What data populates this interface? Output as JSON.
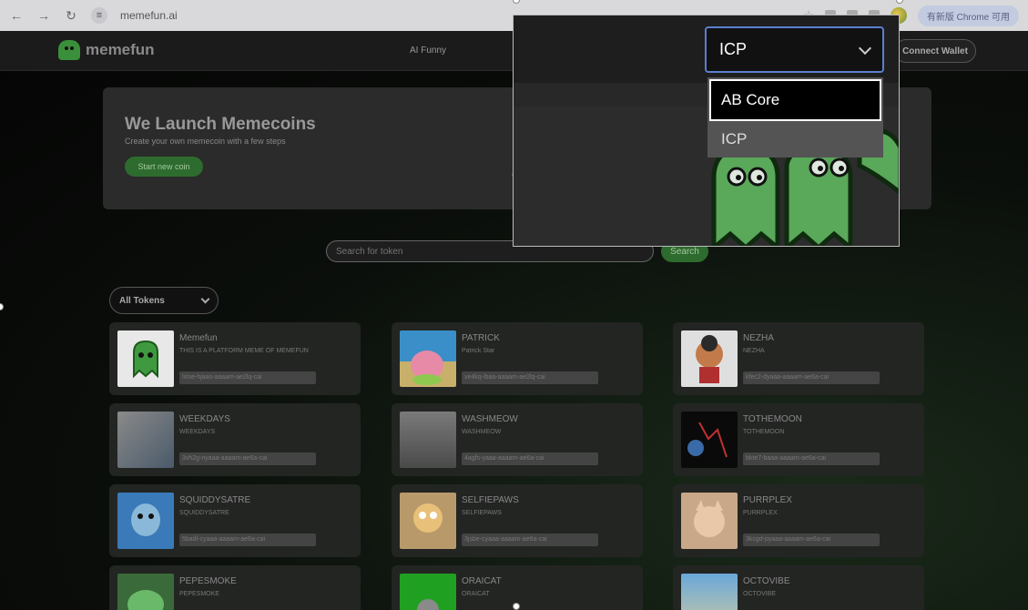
{
  "browser": {
    "url": "memefun.ai",
    "update_label": "有新版 Chrome 可用"
  },
  "header": {
    "logo_text": "memefun",
    "nav_link": "AI Funny",
    "connect_label": "Connect Wallet"
  },
  "hero": {
    "title": "We Launch Memecoins",
    "subtitle": "Create your own memecoin with a few steps",
    "cta": "Start new coin"
  },
  "search": {
    "placeholder": "Search for token",
    "button": "Search"
  },
  "filter": {
    "selected": "All Tokens"
  },
  "tokens": [
    {
      "name": "Memefun",
      "desc": "THIS IS A PLATFORM MEME OF MEMEFUN",
      "addr": "lxlse-hjaas-aaaam-ae2lq-cai"
    },
    {
      "name": "PATRICK",
      "desc": "Patrick Star",
      "addr": "xe4kq-lbaa-aaaam-ae2lq-cai"
    },
    {
      "name": "NEZHA",
      "desc": "NEZHA",
      "addr": "kfec2-dyaaa-aaaam-ae6a-cai"
    },
    {
      "name": "WEEKDAYS",
      "desc": "WEEKDAYS",
      "addr": "3vh2g-nyaaa-aaaam-ae6a-cai"
    },
    {
      "name": "WASHMEOW",
      "desc": "WASHMEOW",
      "addr": "4agfs-yaaa-aaaam-ae6a-cai"
    },
    {
      "name": "TOTHEMOON",
      "desc": "TOTHEMOON",
      "addr": "bkte7-baaa-aaaam-ae6a-cai"
    },
    {
      "name": "SQUIDDYSATRE",
      "desc": "SQUIDDYSATRE",
      "addr": "5badl-cyaaa-aaaam-ae6a-cai"
    },
    {
      "name": "SELFIEPAWS",
      "desc": "SELFIEPAWS",
      "addr": "3jsbe-cyaaa-aaaam-ae6a-cai"
    },
    {
      "name": "PURRPLEX",
      "desc": "PURRPLEX",
      "addr": "3kcgd-pyaaa-aaaam-ae6a-cai"
    },
    {
      "name": "PEPESMOKE",
      "desc": "PEPESMOKE",
      "addr": ""
    },
    {
      "name": "ORAICAT",
      "desc": "ORAICAT",
      "addr": ""
    },
    {
      "name": "OCTOVIBE",
      "desc": "OCTOVIBE",
      "addr": ""
    }
  ],
  "callout": {
    "selected_network": "ICP",
    "options": [
      "AB Core",
      "ICP"
    ],
    "highlighted_option": "AB Core"
  },
  "colors": {
    "accent_green": "#2e6b2e",
    "select_border": "#5b7fd0"
  }
}
